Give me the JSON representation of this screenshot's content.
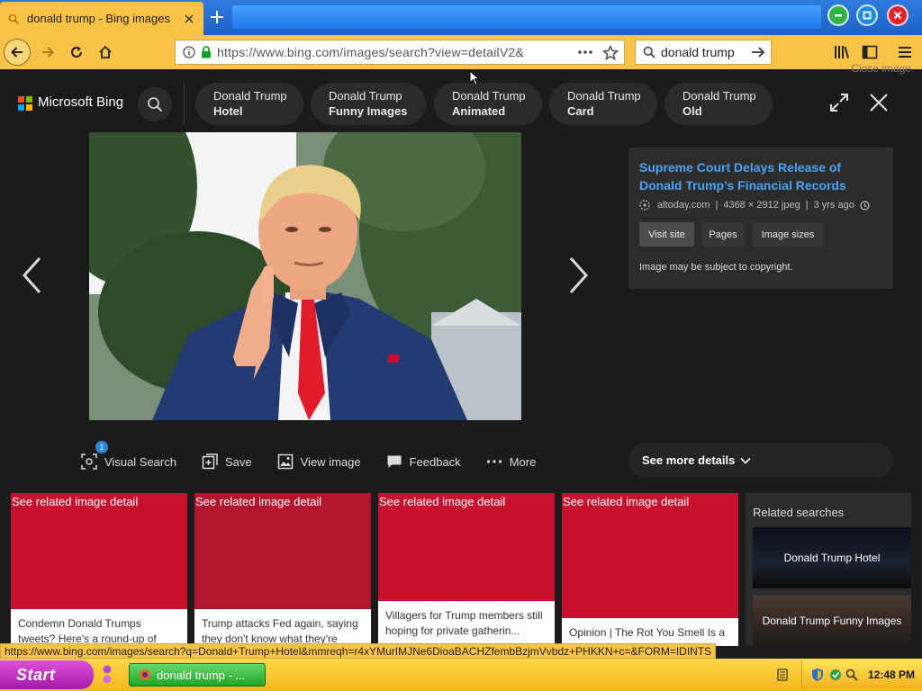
{
  "browser": {
    "tab_title": "donald trump - Bing images",
    "url": "https://www.bing.com/images/search?view=detailV2&",
    "search_value": "donald trump"
  },
  "header": {
    "brand": "Microsoft Bing",
    "close_image_label": "Close image",
    "chips": [
      {
        "line1": "Donald Trump",
        "line2": "Hotel"
      },
      {
        "line1": "Donald Trump",
        "line2": "Funny Images"
      },
      {
        "line1": "Donald Trump",
        "line2": "Animated"
      },
      {
        "line1": "Donald Trump",
        "line2": "Card"
      },
      {
        "line1": "Donald Trump",
        "line2": "Old"
      }
    ]
  },
  "info": {
    "title": "Supreme Court Delays Release of Donald Trump’s Financial Records",
    "source": "altoday.com",
    "dimensions": "4368 × 2912 jpeg",
    "age": "3 yrs ago",
    "buttons": [
      "Visit site",
      "Pages",
      "Image sizes"
    ],
    "copyright": "Image may be subject to copyright."
  },
  "actions": {
    "visual_search_badge": "1",
    "items": [
      "Visual Search",
      "Save",
      "View image",
      "Feedback",
      "More"
    ]
  },
  "see_more_details": "See more details",
  "related_cards": [
    {
      "header": "See related image detail",
      "caption": "Condemn Donald Trumps tweets? Here's a round-up of"
    },
    {
      "header": "See related image detail",
      "caption": "Trump attacks Fed again, saying they don't know what they're"
    },
    {
      "header": "See related image detail",
      "caption": "Villagers for Trump members still hoping for private gatherin..."
    },
    {
      "header": "See related image detail",
      "caption": "Opinion | The Rot You Smell Is a"
    }
  ],
  "related_searches": {
    "title": "Related searches",
    "items": [
      "Donald Trump Hotel",
      "Donald Trump Funny Images"
    ]
  },
  "status_url": "https://www.bing.com/images/search?q=Donald+Trump+Hotel&mmreqh=r4xYMurIMJNe6DioaBACHZfembBzjmVvbdz+PHKKN+c=&FORM=IDINTS",
  "taskbar": {
    "start_label": "Start",
    "task_label": "donald trump - ...",
    "clock": "12:48 PM"
  },
  "colors": {
    "bing_dark": "#1b1b1b",
    "link_blue": "#4aa3f5",
    "card_red": "#c7112e",
    "firefox_yellow": "#f9c346"
  }
}
